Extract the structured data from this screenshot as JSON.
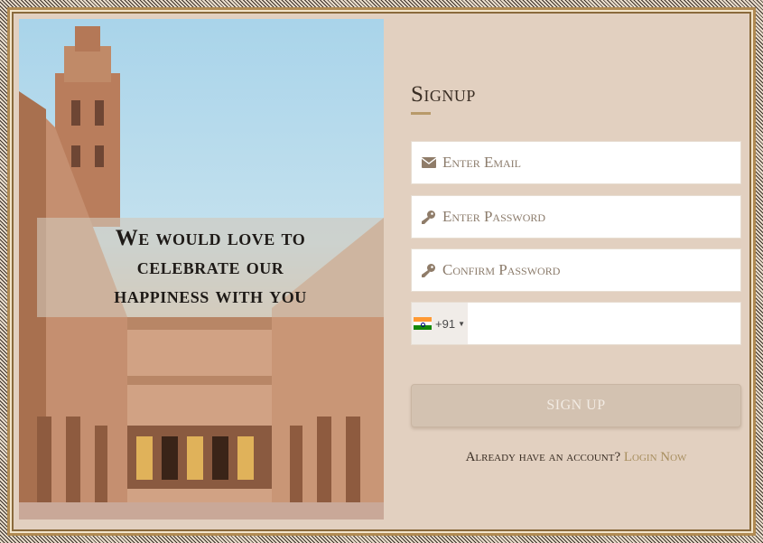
{
  "hero": {
    "line1": "We would love to",
    "line2": "celebrate our",
    "line3": "happiness with you"
  },
  "form": {
    "title": "Signup",
    "email_placeholder": "Enter Email",
    "password_placeholder": "Enter Password",
    "confirm_placeholder": "Confirm Password",
    "phone": {
      "dial_code": "+91",
      "country": "India",
      "flag": "in-flag-icon"
    },
    "submit_label": "SIGN UP",
    "login_prompt": "Already have an account?",
    "login_link": "Login Now"
  },
  "colors": {
    "panel": "#e2d0c0",
    "accent": "#a88f5f",
    "button": "#d3c2b1"
  }
}
